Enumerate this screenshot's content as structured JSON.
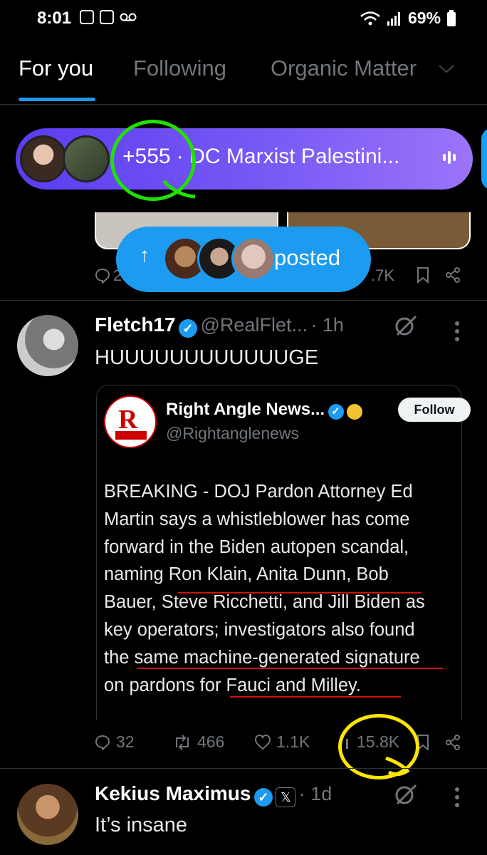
{
  "status_bar": {
    "time": "8:01",
    "battery": "69%"
  },
  "tabs": [
    {
      "label": "For you",
      "active": true
    },
    {
      "label": "Following",
      "active": false
    },
    {
      "label": "Organic Matter",
      "active": false
    }
  ],
  "spaces_pill": {
    "count": "+555",
    "separator": "·",
    "title": "DC Marxist Palestini...",
    "color": "#7b5cf5"
  },
  "new_posts_pill": {
    "label": "posted",
    "color": "#1d9bf0"
  },
  "previous_tweet": {
    "reply_count": "2",
    "views": ".7K"
  },
  "tweet1": {
    "name": "Fletch17",
    "handle": "@RealFlet...",
    "time": "· 1h",
    "text": "HUUUUUUUUUUUUGE",
    "quote": {
      "name": "Right Angle News...",
      "handle": "@Rightanglenews",
      "follow_label": "Follow",
      "text_lines": [
        "BREAKING - DOJ Pardon Attorney Ed",
        "Martin says a whistleblower has come",
        "forward in the Biden autopen scandal,",
        "naming Ron Klain, Anita Dunn, Bob",
        "Bauer, Steve Ricchetti, and Jill Biden as",
        "key operators; investigators also found",
        "the same machine-generated signature",
        "on pardons for Fauci and Milley."
      ]
    },
    "actions": {
      "replies": "32",
      "reposts": "466",
      "likes": "1.1K",
      "views": "15.8K"
    }
  },
  "tweet2": {
    "name": "Kekius Maximus",
    "time": "· 1d",
    "text": "It’s insane"
  },
  "annotation_colors": {
    "green_circle": "#22e000",
    "yellow_circle": "#ffe600",
    "red_underline": "#d01010"
  }
}
